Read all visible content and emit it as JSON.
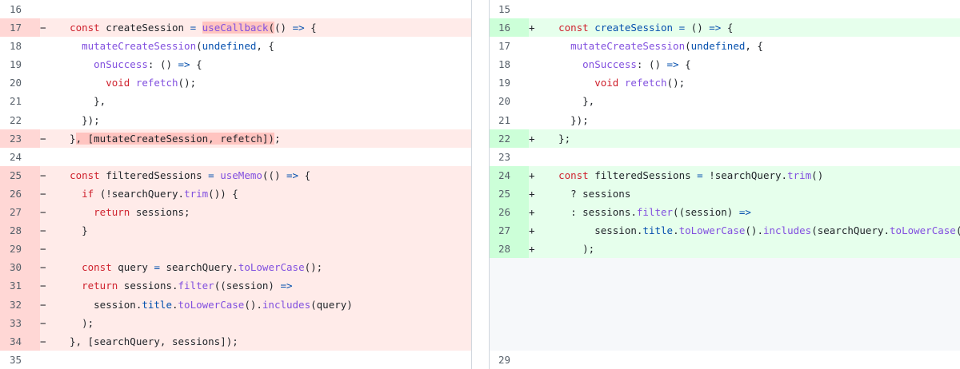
{
  "left": {
    "rows": [
      {
        "ln": "16",
        "type": "context",
        "marker": "",
        "tokens": []
      },
      {
        "ln": "17",
        "type": "del",
        "marker": "−",
        "tokens": [
          {
            "t": "  ",
            "c": "plain"
          },
          {
            "t": "const",
            "c": "kw"
          },
          {
            "t": " createSession ",
            "c": "plain"
          },
          {
            "t": "=",
            "c": "op"
          },
          {
            "t": " ",
            "c": "plain"
          },
          {
            "t": "useCallback",
            "c": "fn",
            "hl": true
          },
          {
            "t": "(",
            "c": "plain",
            "hl": true
          },
          {
            "t": "() ",
            "c": "plain"
          },
          {
            "t": "=>",
            "c": "op"
          },
          {
            "t": " {",
            "c": "plain"
          }
        ]
      },
      {
        "ln": "18",
        "type": "context",
        "marker": "",
        "tokens": [
          {
            "t": "    ",
            "c": "plain"
          },
          {
            "t": "mutateCreateSession",
            "c": "fn"
          },
          {
            "t": "(",
            "c": "plain"
          },
          {
            "t": "undefined",
            "c": "op"
          },
          {
            "t": ", {",
            "c": "plain"
          }
        ]
      },
      {
        "ln": "19",
        "type": "context",
        "marker": "",
        "tokens": [
          {
            "t": "      ",
            "c": "plain"
          },
          {
            "t": "onSuccess",
            "c": "fn"
          },
          {
            "t": ": () ",
            "c": "plain"
          },
          {
            "t": "=>",
            "c": "op"
          },
          {
            "t": " {",
            "c": "plain"
          }
        ]
      },
      {
        "ln": "20",
        "type": "context",
        "marker": "",
        "tokens": [
          {
            "t": "        ",
            "c": "plain"
          },
          {
            "t": "void",
            "c": "kw"
          },
          {
            "t": " ",
            "c": "plain"
          },
          {
            "t": "refetch",
            "c": "fn"
          },
          {
            "t": "();",
            "c": "plain"
          }
        ]
      },
      {
        "ln": "21",
        "type": "context",
        "marker": "",
        "tokens": [
          {
            "t": "      },",
            "c": "plain"
          }
        ]
      },
      {
        "ln": "22",
        "type": "context",
        "marker": "",
        "tokens": [
          {
            "t": "    });",
            "c": "plain"
          }
        ]
      },
      {
        "ln": "23",
        "type": "del",
        "marker": "−",
        "tokens": [
          {
            "t": "  }",
            "c": "plain"
          },
          {
            "t": ", [mutateCreateSession, refetch])",
            "c": "plain",
            "hl": true
          },
          {
            "t": ";",
            "c": "plain"
          }
        ]
      },
      {
        "ln": "24",
        "type": "context",
        "marker": "",
        "tokens": []
      },
      {
        "ln": "25",
        "type": "del",
        "marker": "−",
        "tokens": [
          {
            "t": "  ",
            "c": "plain"
          },
          {
            "t": "const",
            "c": "kw"
          },
          {
            "t": " filteredSessions ",
            "c": "plain"
          },
          {
            "t": "=",
            "c": "op"
          },
          {
            "t": " ",
            "c": "plain"
          },
          {
            "t": "useMemo",
            "c": "fn"
          },
          {
            "t": "(() ",
            "c": "plain"
          },
          {
            "t": "=>",
            "c": "op"
          },
          {
            "t": " {",
            "c": "plain"
          }
        ]
      },
      {
        "ln": "26",
        "type": "del",
        "marker": "−",
        "tokens": [
          {
            "t": "    ",
            "c": "plain"
          },
          {
            "t": "if",
            "c": "kw"
          },
          {
            "t": " (!searchQuery.",
            "c": "plain"
          },
          {
            "t": "trim",
            "c": "fn"
          },
          {
            "t": "()) {",
            "c": "plain"
          }
        ]
      },
      {
        "ln": "27",
        "type": "del",
        "marker": "−",
        "tokens": [
          {
            "t": "      ",
            "c": "plain"
          },
          {
            "t": "return",
            "c": "kw"
          },
          {
            "t": " sessions;",
            "c": "plain"
          }
        ]
      },
      {
        "ln": "28",
        "type": "del",
        "marker": "−",
        "tokens": [
          {
            "t": "    }",
            "c": "plain"
          }
        ]
      },
      {
        "ln": "29",
        "type": "del",
        "marker": "−",
        "tokens": []
      },
      {
        "ln": "30",
        "type": "del",
        "marker": "−",
        "tokens": [
          {
            "t": "    ",
            "c": "plain"
          },
          {
            "t": "const",
            "c": "kw"
          },
          {
            "t": " query ",
            "c": "plain"
          },
          {
            "t": "=",
            "c": "op"
          },
          {
            "t": " searchQuery.",
            "c": "plain"
          },
          {
            "t": "toLowerCase",
            "c": "fn"
          },
          {
            "t": "();",
            "c": "plain"
          }
        ]
      },
      {
        "ln": "31",
        "type": "del",
        "marker": "−",
        "tokens": [
          {
            "t": "    ",
            "c": "plain"
          },
          {
            "t": "return",
            "c": "kw"
          },
          {
            "t": " sessions.",
            "c": "plain"
          },
          {
            "t": "filter",
            "c": "fn"
          },
          {
            "t": "((session) ",
            "c": "plain"
          },
          {
            "t": "=>",
            "c": "op"
          }
        ]
      },
      {
        "ln": "32",
        "type": "del",
        "marker": "−",
        "tokens": [
          {
            "t": "      session.",
            "c": "plain"
          },
          {
            "t": "title",
            "c": "op"
          },
          {
            "t": ".",
            "c": "plain"
          },
          {
            "t": "toLowerCase",
            "c": "fn"
          },
          {
            "t": "().",
            "c": "plain"
          },
          {
            "t": "includes",
            "c": "fn"
          },
          {
            "t": "(query)",
            "c": "plain"
          }
        ]
      },
      {
        "ln": "33",
        "type": "del",
        "marker": "−",
        "tokens": [
          {
            "t": "    );",
            "c": "plain"
          }
        ]
      },
      {
        "ln": "34",
        "type": "del",
        "marker": "−",
        "tokens": [
          {
            "t": "  }, [searchQuery, sessions]);",
            "c": "plain"
          }
        ]
      },
      {
        "ln": "35",
        "type": "context",
        "marker": "",
        "tokens": []
      }
    ]
  },
  "right": {
    "rows": [
      {
        "ln": "15",
        "type": "context",
        "marker": "",
        "tokens": []
      },
      {
        "ln": "16",
        "type": "add",
        "marker": "+",
        "tokens": [
          {
            "t": "  ",
            "c": "plain"
          },
          {
            "t": "const",
            "c": "kw"
          },
          {
            "t": " ",
            "c": "plain"
          },
          {
            "t": "createSession",
            "c": "op"
          },
          {
            "t": " ",
            "c": "plain"
          },
          {
            "t": "=",
            "c": "op"
          },
          {
            "t": " () ",
            "c": "plain"
          },
          {
            "t": "=>",
            "c": "op"
          },
          {
            "t": " {",
            "c": "plain"
          }
        ]
      },
      {
        "ln": "17",
        "type": "context",
        "marker": "",
        "tokens": [
          {
            "t": "    ",
            "c": "plain"
          },
          {
            "t": "mutateCreateSession",
            "c": "fn"
          },
          {
            "t": "(",
            "c": "plain"
          },
          {
            "t": "undefined",
            "c": "op"
          },
          {
            "t": ", {",
            "c": "plain"
          }
        ]
      },
      {
        "ln": "18",
        "type": "context",
        "marker": "",
        "tokens": [
          {
            "t": "      ",
            "c": "plain"
          },
          {
            "t": "onSuccess",
            "c": "fn"
          },
          {
            "t": ": () ",
            "c": "plain"
          },
          {
            "t": "=>",
            "c": "op"
          },
          {
            "t": " {",
            "c": "plain"
          }
        ]
      },
      {
        "ln": "19",
        "type": "context",
        "marker": "",
        "tokens": [
          {
            "t": "        ",
            "c": "plain"
          },
          {
            "t": "void",
            "c": "kw"
          },
          {
            "t": " ",
            "c": "plain"
          },
          {
            "t": "refetch",
            "c": "fn"
          },
          {
            "t": "();",
            "c": "plain"
          }
        ]
      },
      {
        "ln": "20",
        "type": "context",
        "marker": "",
        "tokens": [
          {
            "t": "      },",
            "c": "plain"
          }
        ]
      },
      {
        "ln": "21",
        "type": "context",
        "marker": "",
        "tokens": [
          {
            "t": "    });",
            "c": "plain"
          }
        ]
      },
      {
        "ln": "22",
        "type": "add",
        "marker": "+",
        "tokens": [
          {
            "t": "  };",
            "c": "plain"
          }
        ]
      },
      {
        "ln": "23",
        "type": "context",
        "marker": "",
        "tokens": []
      },
      {
        "ln": "24",
        "type": "add",
        "marker": "+",
        "tokens": [
          {
            "t": "  ",
            "c": "plain"
          },
          {
            "t": "const",
            "c": "kw"
          },
          {
            "t": " filteredSessions ",
            "c": "plain"
          },
          {
            "t": "=",
            "c": "op"
          },
          {
            "t": " !searchQuery.",
            "c": "plain"
          },
          {
            "t": "trim",
            "c": "fn"
          },
          {
            "t": "()",
            "c": "plain"
          }
        ]
      },
      {
        "ln": "25",
        "type": "add",
        "marker": "+",
        "tokens": [
          {
            "t": "    ? sessions",
            "c": "plain"
          }
        ]
      },
      {
        "ln": "26",
        "type": "add",
        "marker": "+",
        "tokens": [
          {
            "t": "    : sessions.",
            "c": "plain"
          },
          {
            "t": "filter",
            "c": "fn"
          },
          {
            "t": "((session) ",
            "c": "plain"
          },
          {
            "t": "=>",
            "c": "op"
          }
        ]
      },
      {
        "ln": "27",
        "type": "add",
        "marker": "+",
        "tokens": [
          {
            "t": "        session.",
            "c": "plain"
          },
          {
            "t": "title",
            "c": "op"
          },
          {
            "t": ".",
            "c": "plain"
          },
          {
            "t": "toLowerCase",
            "c": "fn"
          },
          {
            "t": "().",
            "c": "plain"
          },
          {
            "t": "includes",
            "c": "fn"
          },
          {
            "t": "(searchQuery.",
            "c": "plain"
          },
          {
            "t": "toLowerCase",
            "c": "fn"
          },
          {
            "t": "())",
            "c": "plain"
          }
        ]
      },
      {
        "ln": "28",
        "type": "add",
        "marker": "+",
        "tokens": [
          {
            "t": "      );",
            "c": "plain"
          }
        ]
      },
      {
        "ln": "",
        "type": "empty",
        "marker": "",
        "tokens": []
      },
      {
        "ln": "",
        "type": "empty",
        "marker": "",
        "tokens": []
      },
      {
        "ln": "",
        "type": "empty",
        "marker": "",
        "tokens": []
      },
      {
        "ln": "",
        "type": "empty",
        "marker": "",
        "tokens": []
      },
      {
        "ln": "",
        "type": "empty",
        "marker": "",
        "tokens": []
      },
      {
        "ln": "29",
        "type": "context",
        "marker": "",
        "tokens": []
      }
    ]
  },
  "colors": {
    "del_bg": "#ffebe9",
    "del_gutter": "#ffd7d5",
    "add_bg": "#e6ffec",
    "add_gutter": "#ccffd8",
    "keyword": "#cf222e",
    "function": "#8250df",
    "operator": "#0550ae"
  }
}
